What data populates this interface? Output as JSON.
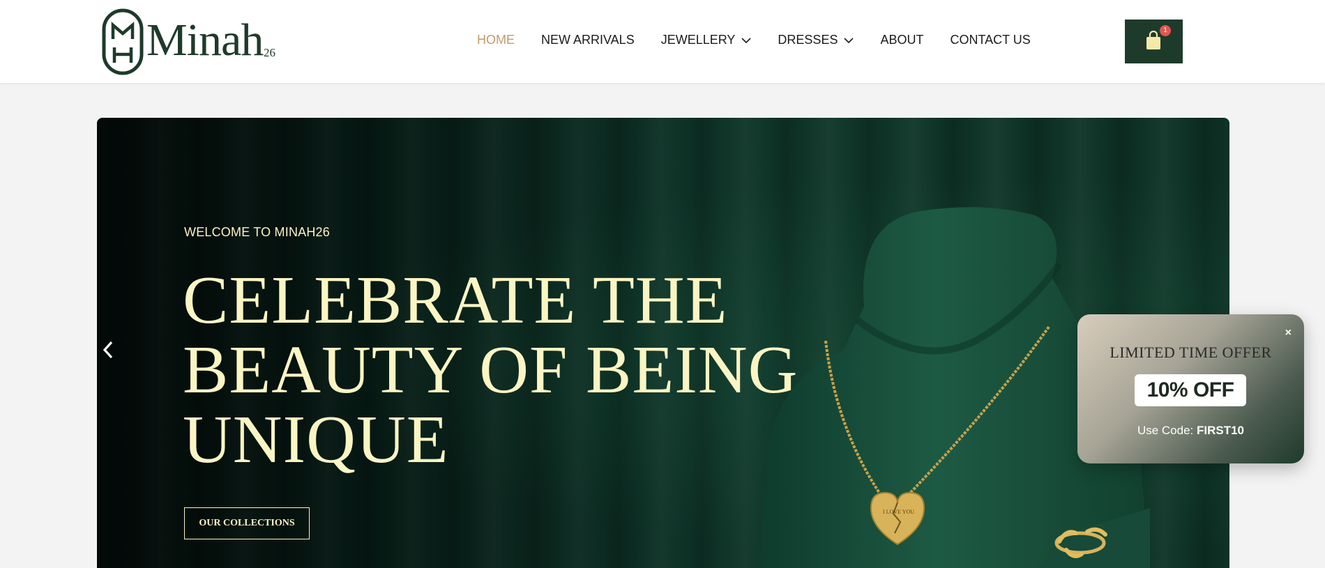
{
  "brand": {
    "name": "Minah",
    "suffix": "26",
    "primary_color": "#1e3a2b",
    "accent_color": "#c19a6b",
    "cream_color": "#fbf5c4"
  },
  "nav": {
    "items": [
      {
        "label": "HOME",
        "active": true
      },
      {
        "label": "NEW ARRIVALS"
      },
      {
        "label": "JEWELLERY",
        "dropdown": true
      },
      {
        "label": "DRESSES",
        "dropdown": true
      },
      {
        "label": "ABOUT"
      },
      {
        "label": "CONTACT US"
      }
    ]
  },
  "cart": {
    "icon": "shopping-bag-icon",
    "count": "1"
  },
  "hero": {
    "welcome": "WELCOME TO MINAH26",
    "headline_line1": "CELEBRATE THE",
    "headline_line2": "BEAUTY OF BEING",
    "headline_line3": "UNIQUE",
    "cta_label": "OUR COLLECTIONS",
    "prev_icon": "chevron-left-icon",
    "pendant_text": "I LOVE YOU"
  },
  "offer": {
    "close_label": "×",
    "title": "LIMITED TIME OFFER",
    "discount": "10% OFF",
    "code_prefix": "Use Code:",
    "code": "FIRST10"
  }
}
